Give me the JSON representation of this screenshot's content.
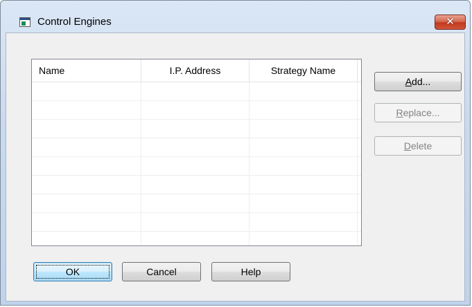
{
  "window": {
    "title": "Control Engines",
    "close_glyph": "✕"
  },
  "table": {
    "columns": [
      "Name",
      "I.P. Address",
      "Strategy Name"
    ],
    "rows": []
  },
  "side_buttons": {
    "add": {
      "underline": "A",
      "rest": "dd...",
      "enabled": true
    },
    "replace": {
      "underline": "R",
      "rest": "eplace...",
      "enabled": false
    },
    "delete": {
      "underline": "D",
      "rest": "elete",
      "enabled": false
    }
  },
  "bottom_buttons": {
    "ok": "OK",
    "cancel": "Cancel",
    "help": "Help"
  },
  "icons": {
    "window_icon": "application-window-icon",
    "close": "close-icon"
  },
  "colors": {
    "close_button": "#c2391e",
    "default_button_border": "#3c7fb1"
  }
}
